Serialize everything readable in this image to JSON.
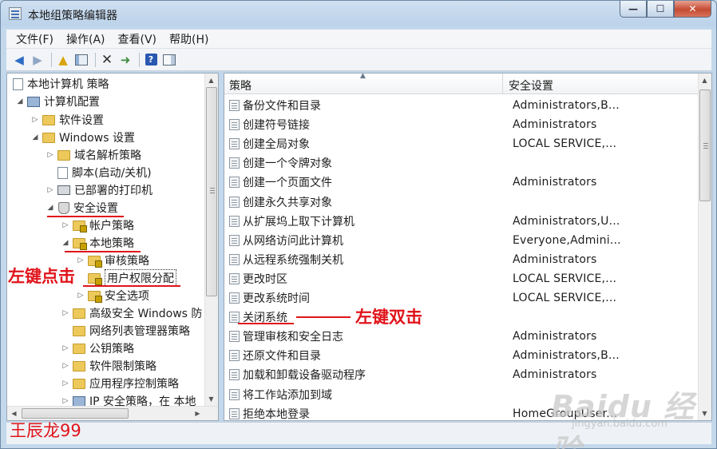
{
  "window": {
    "title": "本地组策略编辑器",
    "controls": {
      "minimize": "—",
      "maximize": "☐",
      "close": "✕"
    }
  },
  "menu": [
    "文件(F)",
    "操作(A)",
    "查看(V)",
    "帮助(H)"
  ],
  "toolbar_icons": [
    "back-arrow-icon",
    "forward-arrow-icon",
    "up-folder-icon",
    "show-hide-tree-icon",
    "delete-icon",
    "export-list-icon",
    "help-icon",
    "properties-pane-icon"
  ],
  "toolbar": {
    "help_label": "?"
  },
  "tree": {
    "root": "本地计算机 策略",
    "items": [
      {
        "label": "计算机配置",
        "expander": "◢"
      },
      {
        "label": "软件设置",
        "expander": "▷"
      },
      {
        "label": "Windows 设置",
        "expander": "◢"
      },
      {
        "label": "域名解析策略",
        "expander": "▷"
      },
      {
        "label": "脚本(启动/关机)",
        "expander": ""
      },
      {
        "label": "已部署的打印机",
        "expander": "▷"
      },
      {
        "label": "安全设置",
        "expander": "◢"
      },
      {
        "label": "帐户策略",
        "expander": "▷"
      },
      {
        "label": "本地策略",
        "expander": "◢"
      },
      {
        "label": "审核策略",
        "expander": "▷"
      },
      {
        "label": "用户权限分配",
        "expander": ""
      },
      {
        "label": "安全选项",
        "expander": "▷"
      },
      {
        "label": "高级安全 Windows 防",
        "expander": "▷"
      },
      {
        "label": "网络列表管理器策略",
        "expander": ""
      },
      {
        "label": "公钥策略",
        "expander": "▷"
      },
      {
        "label": "软件限制策略",
        "expander": "▷"
      },
      {
        "label": "应用程序控制策略",
        "expander": "▷"
      },
      {
        "label": "IP 安全策略，在 本地",
        "expander": "▷"
      }
    ]
  },
  "list": {
    "columns": [
      "策略",
      "安全设置"
    ],
    "sort_indicator": "▲",
    "rows": [
      {
        "policy": "备份文件和目录",
        "setting": "Administrators,B..."
      },
      {
        "policy": "创建符号链接",
        "setting": "Administrators"
      },
      {
        "policy": "创建全局对象",
        "setting": "LOCAL SERVICE,..."
      },
      {
        "policy": "创建一个令牌对象",
        "setting": ""
      },
      {
        "policy": "创建一个页面文件",
        "setting": "Administrators"
      },
      {
        "policy": "创建永久共享对象",
        "setting": ""
      },
      {
        "policy": "从扩展坞上取下计算机",
        "setting": "Administrators,U..."
      },
      {
        "policy": "从网络访问此计算机",
        "setting": "Everyone,Admini..."
      },
      {
        "policy": "从远程系统强制关机",
        "setting": "Administrators"
      },
      {
        "policy": "更改时区",
        "setting": "LOCAL SERVICE,..."
      },
      {
        "policy": "更改系统时间",
        "setting": "LOCAL SERVICE,..."
      },
      {
        "policy": "关闭系统",
        "setting": ""
      },
      {
        "policy": "管理审核和安全日志",
        "setting": "Administrators"
      },
      {
        "policy": "还原文件和目录",
        "setting": "Administrators,B..."
      },
      {
        "policy": "加载和卸载设备驱动程序",
        "setting": "Administrators"
      },
      {
        "policy": "将工作站添加到域",
        "setting": ""
      },
      {
        "policy": "拒绝本地登录",
        "setting": "HomeGroupUser..."
      }
    ]
  },
  "annotations": {
    "left_click": "左键点击",
    "double_click": "左键双击",
    "author": "王辰龙99",
    "watermark": "Baidu 经验",
    "watermark_url": "jingyan.baidu.com"
  },
  "colors": {
    "annotation_red": "#e0141b",
    "title_bar": "#c4d8ec",
    "close_button": "#c54a32"
  }
}
